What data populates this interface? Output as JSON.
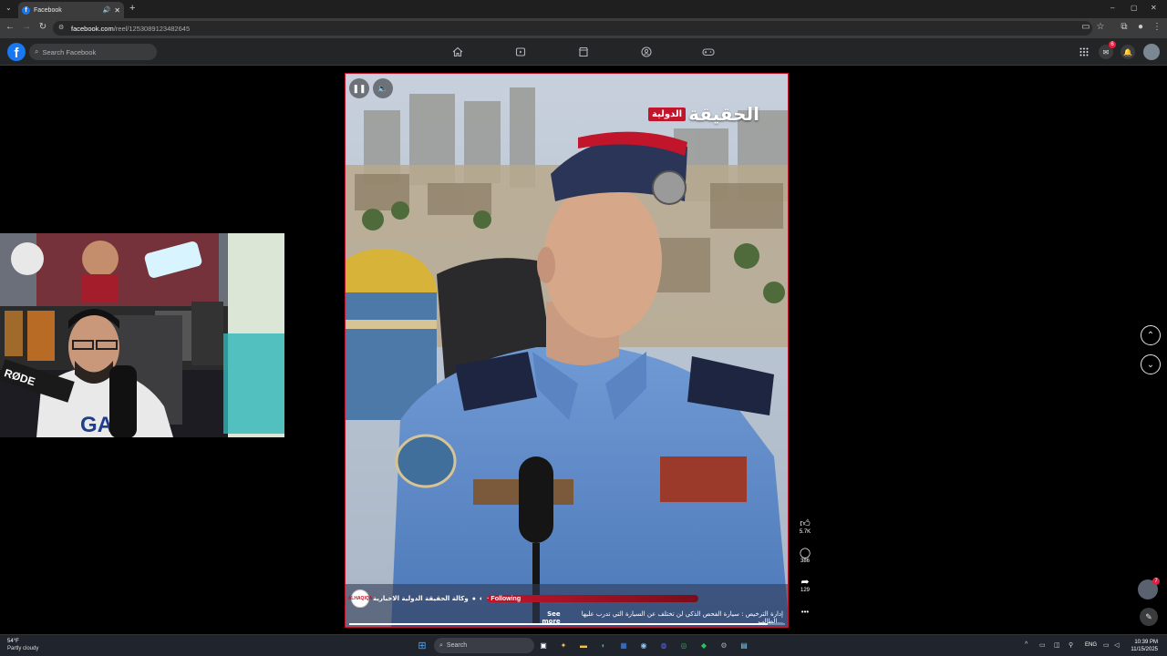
{
  "browser": {
    "tab_title": "Facebook",
    "new_tab_label": "+",
    "url_host": "facebook.com",
    "url_path": "/reel/1253089123482645"
  },
  "facebook": {
    "logo": "f",
    "search_placeholder": "Search Facebook",
    "nav_icons": [
      "home-icon",
      "video-icon",
      "marketplace-icon",
      "groups-icon",
      "gaming-icon"
    ],
    "messenger_badge": "6",
    "avatar_badge": "7"
  },
  "reel": {
    "channel_logo_main": "الحقيقة",
    "channel_logo_sub": "الدولية",
    "author_name": "وكالة الحقيقة الدولية الاخبارية",
    "author_avatar_text": "ALHAQIQA",
    "following_label": "· Following",
    "caption": "إدارة الترخيص : سيارة الفحص الذكي لن تختلف عن السيارة التي تدرب عليها الطالب...",
    "see_more": "See more",
    "progress": 0.96,
    "likes": "5.7K",
    "comments": "386",
    "shares": "129",
    "more": "•••"
  },
  "taskbar": {
    "temperature": "54°F",
    "weather": "Partly cloudy",
    "search_placeholder": "Search",
    "language": "ENG",
    "time": "10:39 PM",
    "date": "11/15/2025"
  },
  "colors": {
    "accent": "#1877f2",
    "reel_border": "#c0152a",
    "notification": "#e41e3f"
  }
}
